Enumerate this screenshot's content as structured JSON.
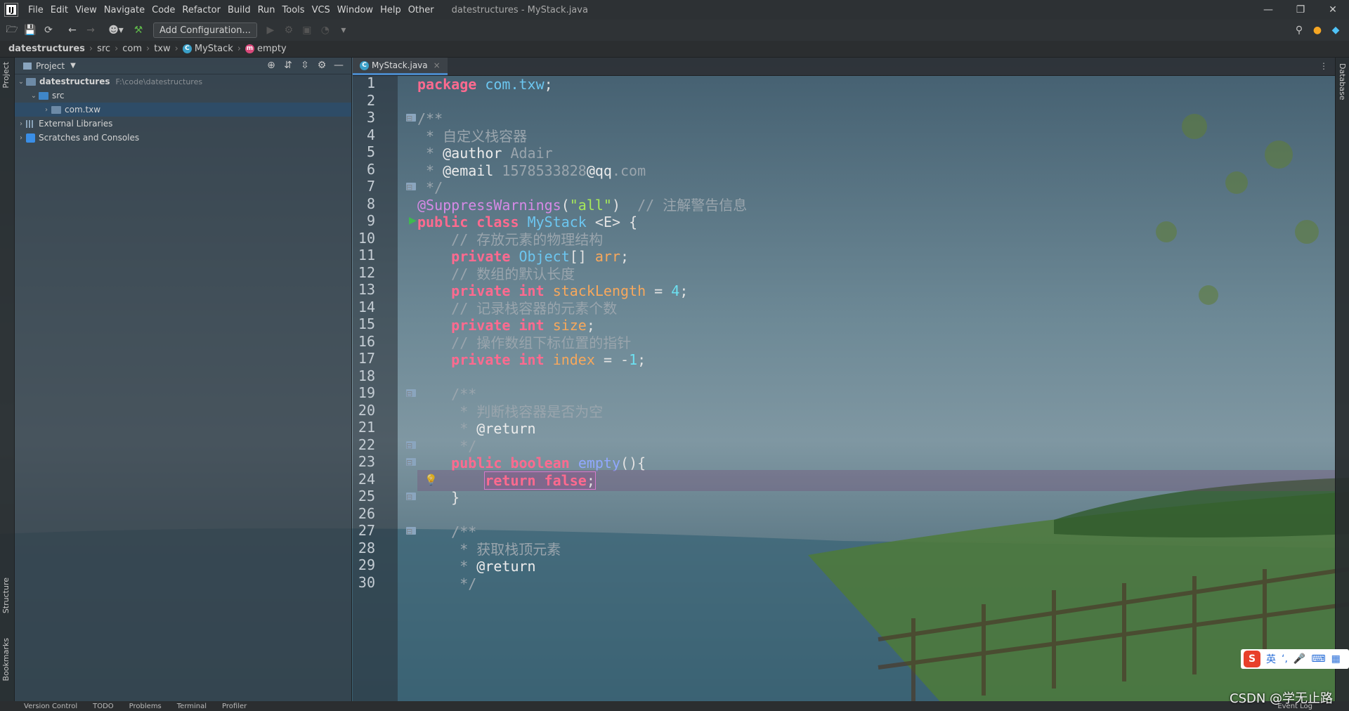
{
  "app": {
    "window_title": "datestructures - MyStack.java",
    "logo_text": "IJ"
  },
  "menu": [
    "File",
    "Edit",
    "View",
    "Navigate",
    "Code",
    "Refactor",
    "Build",
    "Run",
    "Tools",
    "VCS",
    "Window",
    "Help",
    "Other"
  ],
  "toolbar": {
    "add_configuration": "Add Configuration..."
  },
  "breadcrumb": [
    "datestructures",
    "src",
    "com",
    "txw",
    "MyStack",
    "empty"
  ],
  "project_panel": {
    "title": "Project",
    "tree": [
      {
        "label": "datestructures",
        "path": "F:\\code\\datestructures",
        "level": 0,
        "expanded": true,
        "bold": true
      },
      {
        "label": "src",
        "level": 1,
        "expanded": true
      },
      {
        "label": "com.txw",
        "level": 2,
        "expanded": false,
        "selected": true
      },
      {
        "label": "External Libraries",
        "level": 0,
        "expanded": false
      },
      {
        "label": "Scratches and Consoles",
        "level": 0,
        "expanded": false
      }
    ]
  },
  "left_strip_tabs": [
    "Project",
    "Structure",
    "Bookmarks"
  ],
  "right_strip_tabs": [
    "Database"
  ],
  "editor": {
    "tab_label": "MyStack.java",
    "current_line": 24,
    "lines": [
      {
        "n": "1",
        "t": "package com.txw;"
      },
      {
        "n": "2",
        "t": ""
      },
      {
        "n": "3",
        "t": "/**"
      },
      {
        "n": "4",
        "t": " * 自定义栈容器"
      },
      {
        "n": "5",
        "t": " * @author Adair"
      },
      {
        "n": "6",
        "t": " * @email 1578533828@qq.com"
      },
      {
        "n": "7",
        "t": " */"
      },
      {
        "n": "8",
        "t": "@SuppressWarnings(\"all\")  // 注解警告信息"
      },
      {
        "n": "9",
        "t": "public class MyStack <E> {"
      },
      {
        "n": "10",
        "t": "    // 存放元素的物理结构"
      },
      {
        "n": "11",
        "t": "    private Object[] arr;"
      },
      {
        "n": "12",
        "t": "    // 数组的默认长度"
      },
      {
        "n": "13",
        "t": "    private int stackLength = 4;"
      },
      {
        "n": "14",
        "t": "    // 记录栈容器的元素个数"
      },
      {
        "n": "15",
        "t": "    private int size;"
      },
      {
        "n": "16",
        "t": "    // 操作数组下标位置的指针"
      },
      {
        "n": "17",
        "t": "    private int index = -1;"
      },
      {
        "n": "18",
        "t": ""
      },
      {
        "n": "19",
        "t": "    /**"
      },
      {
        "n": "20",
        "t": "     * 判断栈容器是否为空"
      },
      {
        "n": "21",
        "t": "     * @return"
      },
      {
        "n": "22",
        "t": "     */"
      },
      {
        "n": "23",
        "t": "    public boolean empty(){"
      },
      {
        "n": "24",
        "t": "        return false;"
      },
      {
        "n": "25",
        "t": "    }"
      },
      {
        "n": "26",
        "t": ""
      },
      {
        "n": "27",
        "t": "    /**"
      },
      {
        "n": "28",
        "t": "     * 获取栈顶元素"
      },
      {
        "n": "29",
        "t": "     * @return"
      },
      {
        "n": "30",
        "t": "     */"
      }
    ]
  },
  "status_bar": [
    "Version Control",
    "TODO",
    "Problems",
    "Terminal",
    "Profiler"
  ],
  "status_right": "Event Log",
  "ime": {
    "brand": "S",
    "mode": "英"
  },
  "watermark": "CSDN @学无止路",
  "colors": {
    "keyword": "#ff6a8f",
    "class": "#6cc6f0",
    "field": "#f7a85c",
    "number": "#6ce0f0",
    "string": "#a6e85a",
    "comment": "#9aa5ad",
    "annotation": "#d68ae6",
    "method": "#90a8ff"
  }
}
